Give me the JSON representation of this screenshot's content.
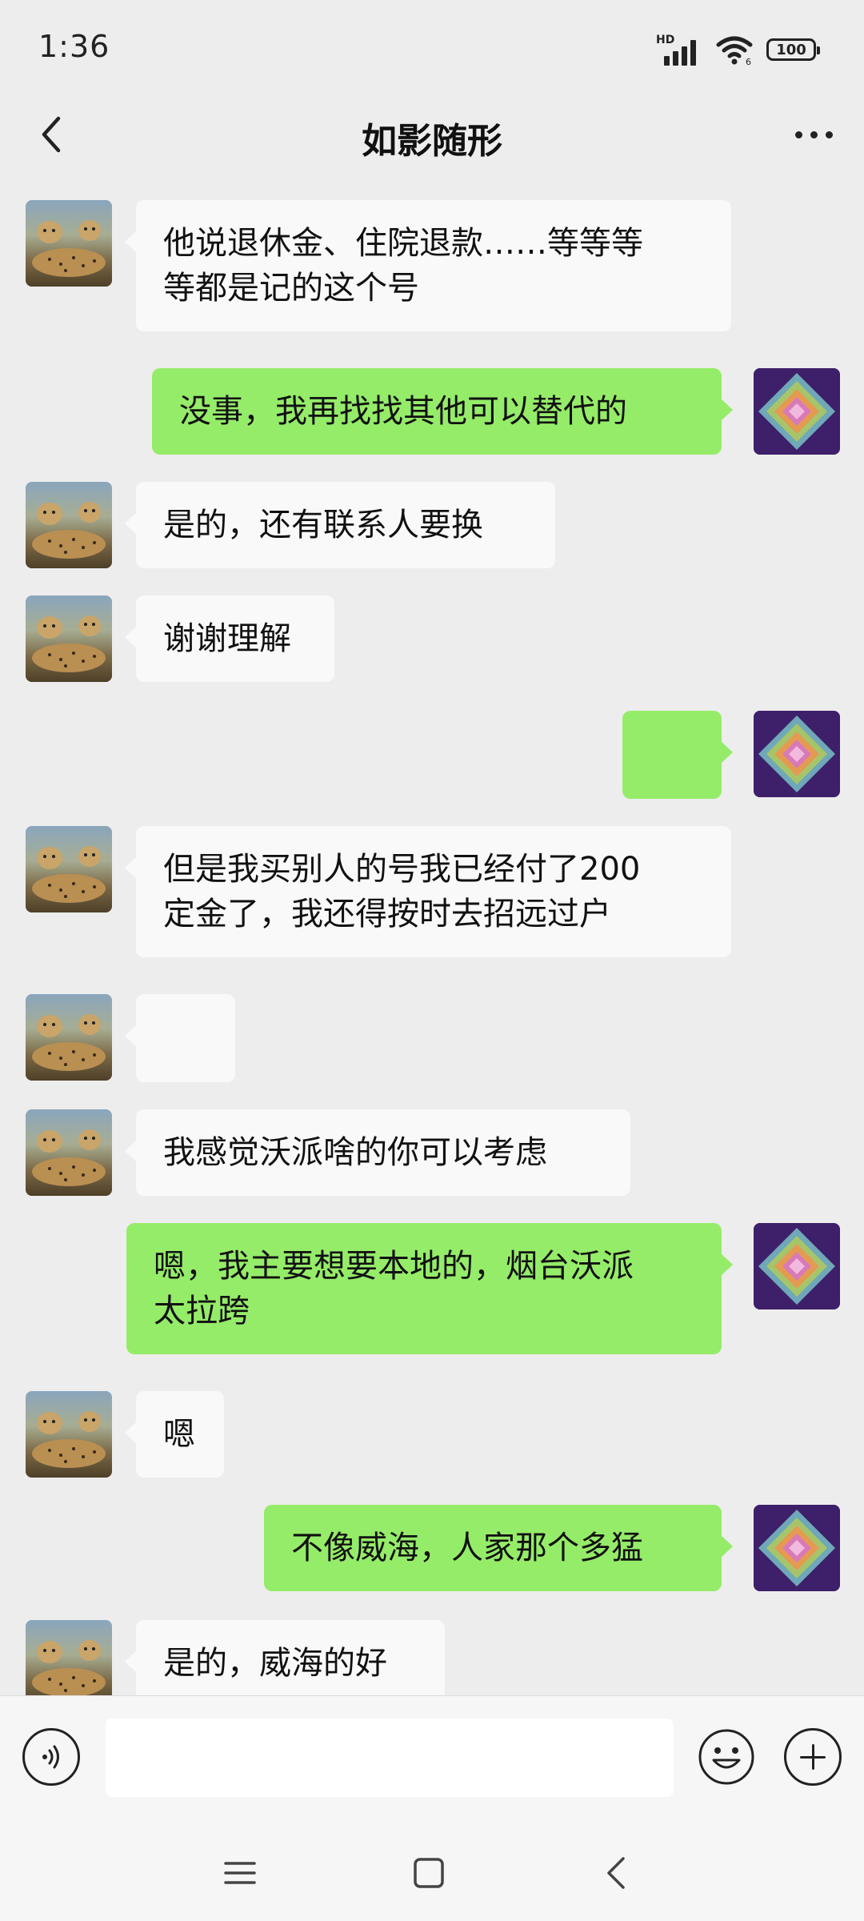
{
  "status_bar": {
    "time": "1:36",
    "network_label": "HD",
    "battery": "100"
  },
  "header": {
    "title": "如影随形",
    "back_icon": "chevron-left-icon",
    "more_icon": "more-dots-icon"
  },
  "messages": [
    {
      "side": "left",
      "type": "text",
      "text": "他说退休金、住院退款……等等等\n等都是记的这个号"
    },
    {
      "side": "right",
      "type": "text",
      "text": "没事，我再找找其他可以替代的"
    },
    {
      "side": "left",
      "type": "text",
      "text": "是的，还有联系人要换"
    },
    {
      "side": "left",
      "type": "text",
      "text": "谢谢理解"
    },
    {
      "side": "right",
      "type": "emoji",
      "emoji": "handshake-icon"
    },
    {
      "side": "left",
      "type": "text",
      "text": "但是我买别人的号我已经付了200\n定金了，我还得按时去招远过户"
    },
    {
      "side": "left",
      "type": "emoji",
      "emoji": "handshake-icon"
    },
    {
      "side": "left",
      "type": "text",
      "text": "我感觉沃派啥的你可以考虑"
    },
    {
      "side": "right",
      "type": "text",
      "text": "嗯，我主要想要本地的，烟台沃派\n太拉跨"
    },
    {
      "side": "left",
      "type": "text",
      "text": "嗯"
    },
    {
      "side": "right",
      "type": "text",
      "text": "不像威海，人家那个多猛"
    },
    {
      "side": "left",
      "type": "text",
      "text": "是的，威海的好"
    }
  ],
  "input_bar": {
    "voice_icon": "voice-icon",
    "input_value": "",
    "emoji_icon": "smiley-icon",
    "plus_icon": "plus-icon"
  },
  "nav_bar": {
    "menu_icon": "menu-icon",
    "home_icon": "home-icon",
    "back_icon": "back-icon"
  },
  "colors": {
    "background": "#ededed",
    "bubble_self": "#95ec69",
    "bubble_other": "#f9f9f9"
  }
}
